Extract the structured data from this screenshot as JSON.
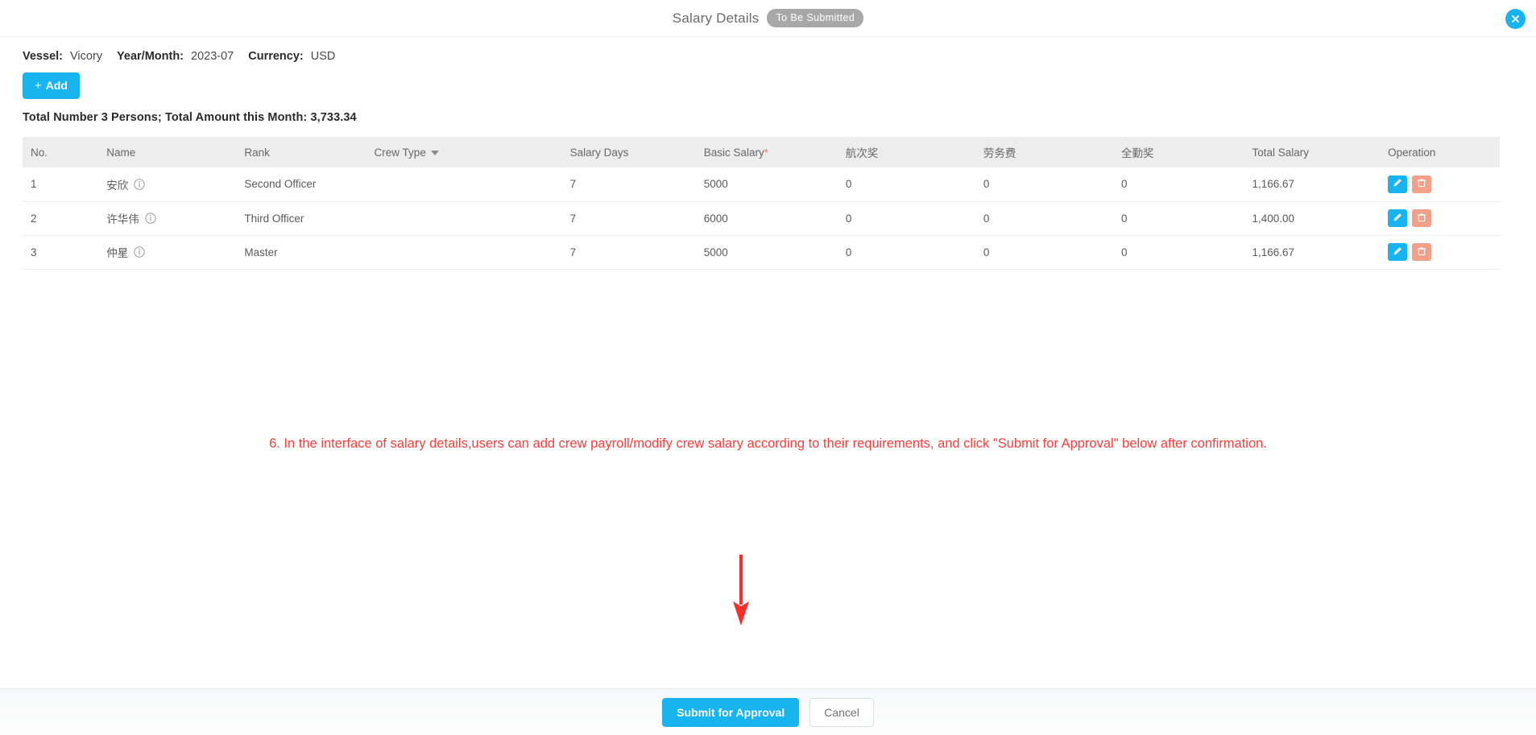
{
  "dialog": {
    "title": "Salary Details",
    "status_badge": "To Be Submitted",
    "close_icon": "close-icon"
  },
  "meta": {
    "vessel_label": "Vessel:",
    "vessel_value": "Vicory",
    "yearmonth_label": "Year/Month:",
    "yearmonth_value": "2023-07",
    "currency_label": "Currency:",
    "currency_value": "USD"
  },
  "toolbar": {
    "add_label": "Add",
    "add_plus": "+"
  },
  "totals": {
    "text": "Total Number 3 Persons;  Total Amount this Month:  3,733.34",
    "person_count": 3,
    "total_amount": "3,733.34"
  },
  "table": {
    "columns": [
      {
        "key": "no",
        "label": "No."
      },
      {
        "key": "name",
        "label": "Name"
      },
      {
        "key": "rank",
        "label": "Rank"
      },
      {
        "key": "crew",
        "label": "Crew Type",
        "has_caret": true
      },
      {
        "key": "days",
        "label": "Salary Days"
      },
      {
        "key": "basic",
        "label": "Basic Salary",
        "required": "*"
      },
      {
        "key": "voy",
        "label": "航次奖"
      },
      {
        "key": "labor",
        "label": "劳务费"
      },
      {
        "key": "attend",
        "label": "全勤奖"
      },
      {
        "key": "total",
        "label": "Total Salary"
      },
      {
        "key": "op",
        "label": "Operation"
      }
    ],
    "rows": [
      {
        "no": "1",
        "name": "安欣",
        "rank": "Second Officer",
        "crew": "",
        "days": "7",
        "basic": "5000",
        "voy": "0",
        "labor": "0",
        "attend": "0",
        "total": "1,166.67"
      },
      {
        "no": "2",
        "name": "许华伟",
        "rank": "Third Officer",
        "crew": "",
        "days": "7",
        "basic": "6000",
        "voy": "0",
        "labor": "0",
        "attend": "0",
        "total": "1,400.00"
      },
      {
        "no": "3",
        "name": "仲星",
        "rank": "Master",
        "crew": "",
        "days": "7",
        "basic": "5000",
        "voy": "0",
        "labor": "0",
        "attend": "0",
        "total": "1,166.67"
      }
    ]
  },
  "annotation": {
    "text": "6. In the interface of salary details,users can add crew payroll/modify crew salary according to their requirements, and click \"Submit for Approval\" below after confirmation.",
    "color": "#fc3d3d",
    "arrow_color": "#fb2c2c"
  },
  "footer": {
    "submit_label": "Submit for Approval",
    "cancel_label": "Cancel"
  },
  "colors": {
    "accent": "#18b4f0",
    "badge_gray": "#a8a8a8",
    "delete_salmon": "#f3a08a",
    "header_bg": "#ededed",
    "required_star": "#f56c6c"
  }
}
